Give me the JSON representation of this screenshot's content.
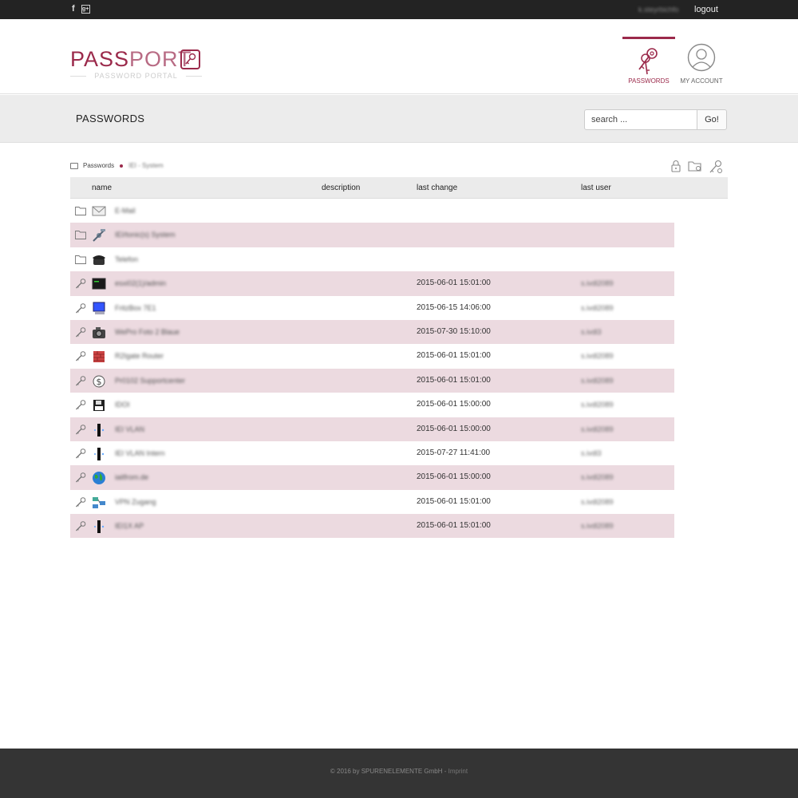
{
  "topbar": {
    "facebook": "f",
    "gplus": "g+",
    "username": "k.steyrbichfo",
    "logout": "logout"
  },
  "logo": {
    "word_bold": "PASS",
    "word_light": "PORT",
    "subtitle": "PASSWORD PORTAL",
    "brand_color": "#9b2a4b"
  },
  "nav": {
    "passwords": "PASSWORDS",
    "account": "MY ACCOUNT"
  },
  "page": {
    "title": "PASSWORDS"
  },
  "search": {
    "placeholder": "search ...",
    "button": "Go!"
  },
  "breadcrumb": {
    "root": "Passwords",
    "current": "IEI - System"
  },
  "table": {
    "headers": {
      "name": "name",
      "description": "description",
      "last_change": "last change",
      "last_user": "last user"
    },
    "rows": [
      {
        "kind": "folder",
        "icon": "mail-icon",
        "name": "E-Mail",
        "date": "",
        "user": ""
      },
      {
        "kind": "folder",
        "icon": "satellite-icon",
        "name": "IEI/tonic(s) System",
        "date": "",
        "user": ""
      },
      {
        "kind": "folder",
        "icon": "telephone-icon",
        "name": "Telefon",
        "date": "",
        "user": ""
      },
      {
        "kind": "key",
        "icon": "terminal-icon",
        "name": "esxi02(1)/admin",
        "date": "2015-06-01 15:01:00",
        "user": "s.ivdl2089"
      },
      {
        "kind": "key",
        "icon": "computer-icon",
        "name": "FritzBox 7E1",
        "date": "2015-06-15 14:06:00",
        "user": "s.ivdl2089"
      },
      {
        "kind": "key",
        "icon": "camera-icon",
        "name": "WePro Foto 2 Blaue",
        "date": "2015-07-30 15:10:00",
        "user": "s.ivdl3"
      },
      {
        "kind": "key",
        "icon": "firewall-icon",
        "name": "R2Igate Router",
        "date": "2015-06-01 15:01:00",
        "user": "s.ivdl2089"
      },
      {
        "kind": "key",
        "icon": "dollar-icon",
        "name": "Pr0102 Supportcenter",
        "date": "2015-06-01 15:01:00",
        "user": "s.ivdl2089"
      },
      {
        "kind": "key",
        "icon": "floppy-icon",
        "name": "IDOI",
        "date": "2015-06-01 15:00:00",
        "user": "s.ivdl2089"
      },
      {
        "kind": "key",
        "icon": "server-icon",
        "name": "IEI VLAN",
        "date": "2015-06-01 15:00:00",
        "user": "s.ivdl2089"
      },
      {
        "kind": "key",
        "icon": "server-icon",
        "name": "IEI VLAN Intern",
        "date": "2015-07-27 11:41:00",
        "user": "s.ivdl3"
      },
      {
        "kind": "key",
        "icon": "globe-icon",
        "name": "iaitfrom.de",
        "date": "2015-06-01 15:00:00",
        "user": "s.ivdl2089"
      },
      {
        "kind": "key",
        "icon": "network-icon",
        "name": "VPN Zugang",
        "date": "2015-06-01 15:01:00",
        "user": "s.ivdl2089"
      },
      {
        "kind": "key",
        "icon": "server-icon",
        "name": "IEI1X AP",
        "date": "2015-06-01 15:01:00",
        "user": "s.ivdl2089"
      }
    ]
  },
  "footer": {
    "copyright": "© 2016 by  SPURENELEMENTE GmbH - ",
    "imprint": "Imprint"
  }
}
